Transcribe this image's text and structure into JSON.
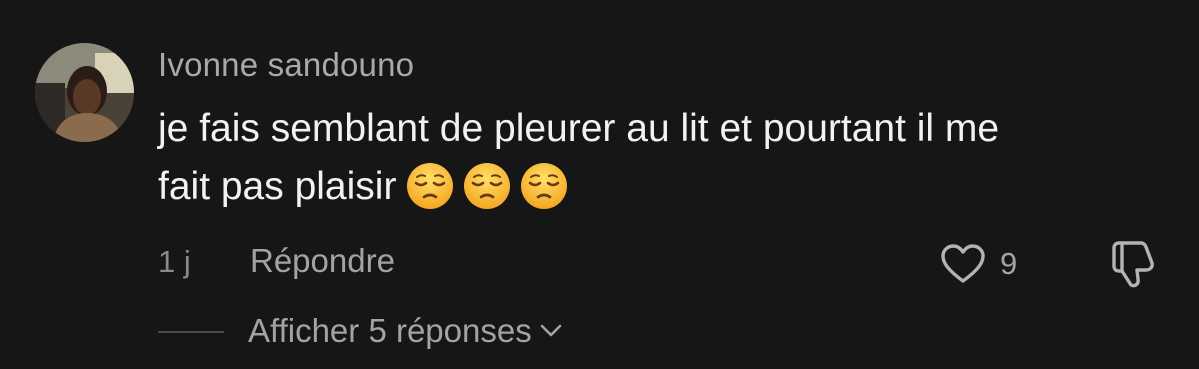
{
  "comment": {
    "username": "Ivonne sandouno",
    "text_line1": "je fais semblant de pleurer au lit et pourtant il me",
    "text_line2": "fait pas plaisir",
    "emojis": [
      "pensive-face-emoji",
      "pensive-face-emoji",
      "pensive-face-emoji"
    ],
    "time_ago": "1 j",
    "reply_label": "Répondre",
    "like_count": "9",
    "view_replies_label": "Afficher 5 réponses"
  },
  "icons": {
    "like": "heart-outline-icon",
    "dislike": "thumbs-down-outline-icon",
    "expand": "chevron-down-icon"
  },
  "colors": {
    "background": "#161616",
    "username": "#a9a9a9",
    "text": "#f2f2f2",
    "secondary": "#a3a3a3",
    "emoji_face": "#fcc21b"
  }
}
